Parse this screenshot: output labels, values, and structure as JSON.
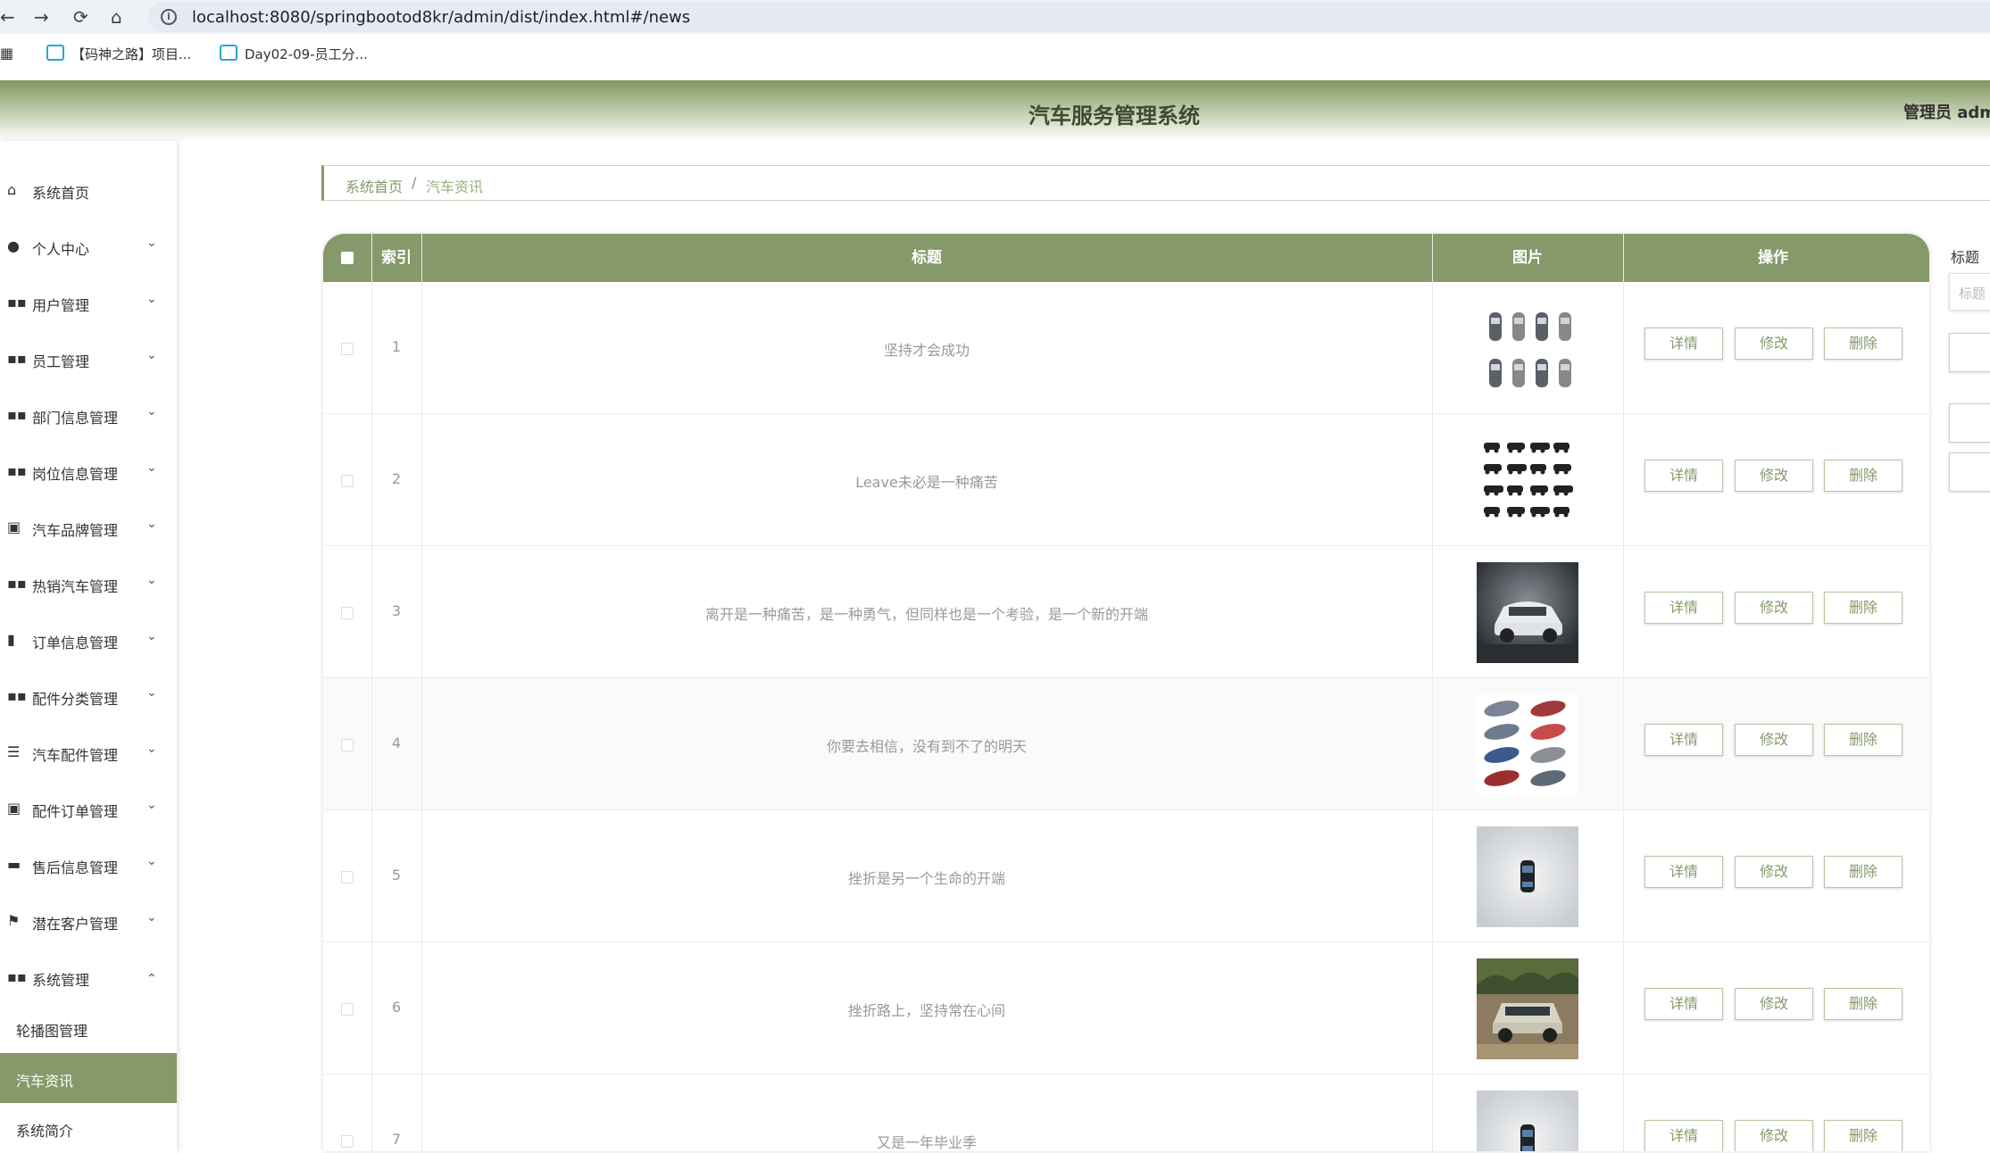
{
  "browser": {
    "url": "localhost:8080/springbootod8kr/admin/dist/index.html#/news",
    "bookmarks": [
      "【码神之路】项目...",
      "Day02-09-员工分..."
    ]
  },
  "header": {
    "title": "汽车服务管理系统",
    "user": "管理员 adm"
  },
  "sidebar": {
    "items": [
      {
        "label": "系统首页",
        "icon": "home-icon",
        "expandable": false
      },
      {
        "label": "个人中心",
        "icon": "user-icon",
        "expandable": true
      },
      {
        "label": "用户管理",
        "icon": "grid-icon",
        "expandable": true
      },
      {
        "label": "员工管理",
        "icon": "grid-icon",
        "expandable": true
      },
      {
        "label": "部门信息管理",
        "icon": "grid-icon",
        "expandable": true
      },
      {
        "label": "岗位信息管理",
        "icon": "grid-icon",
        "expandable": true
      },
      {
        "label": "汽车品牌管理",
        "icon": "clipboard-icon",
        "expandable": true
      },
      {
        "label": "热销汽车管理",
        "icon": "grid-icon",
        "expandable": true
      },
      {
        "label": "订单信息管理",
        "icon": "bar-chart-icon",
        "expandable": true
      },
      {
        "label": "配件分类管理",
        "icon": "grid-icon",
        "expandable": true
      },
      {
        "label": "汽车配件管理",
        "icon": "list-icon",
        "expandable": true
      },
      {
        "label": "配件订单管理",
        "icon": "clipboard-icon",
        "expandable": true
      },
      {
        "label": "售后信息管理",
        "icon": "car-icon",
        "expandable": true
      },
      {
        "label": "潜在客户管理",
        "icon": "flag-icon",
        "expandable": true
      },
      {
        "label": "系统管理",
        "icon": "grid-icon",
        "expandable": true,
        "expanded": true
      }
    ],
    "sub_items": [
      {
        "label": "轮播图管理",
        "active": false
      },
      {
        "label": "汽车资讯",
        "active": true
      },
      {
        "label": "系统简介",
        "active": false
      }
    ]
  },
  "breadcrumb": {
    "home": "系统首页",
    "separator": "/",
    "current": "汽车资讯"
  },
  "table": {
    "columns": [
      "索引",
      "标题",
      "图片",
      "操作"
    ],
    "actions": {
      "view": "详情",
      "edit": "修改",
      "delete": "删除"
    },
    "rows": [
      {
        "index": "1",
        "title": "坚持才会成功",
        "image": "car-icons-grid"
      },
      {
        "index": "2",
        "title": "Leave未必是一种痛苦",
        "image": "vehicle-silhouettes"
      },
      {
        "index": "3",
        "title": "离开是一种痛苦，是一种勇气，但同样也是一个考验，是一个新的开端",
        "image": "white-suv-photo"
      },
      {
        "index": "4",
        "title": "你要去相信，没有到不了的明天",
        "image": "car-models-collage"
      },
      {
        "index": "5",
        "title": "挫折是另一个生命的开端",
        "image": "top-view-car"
      },
      {
        "index": "6",
        "title": "挫折路上，坚持常在心间",
        "image": "offroad-suv-photo"
      },
      {
        "index": "7",
        "title": "又是一年毕业季",
        "image": "top-view-car"
      }
    ]
  },
  "search": {
    "label": "标题",
    "placeholder": "标题"
  },
  "colors": {
    "accent": "#85996a",
    "header_gradient_top": "#7f975f",
    "accent_text": "#85996a"
  }
}
